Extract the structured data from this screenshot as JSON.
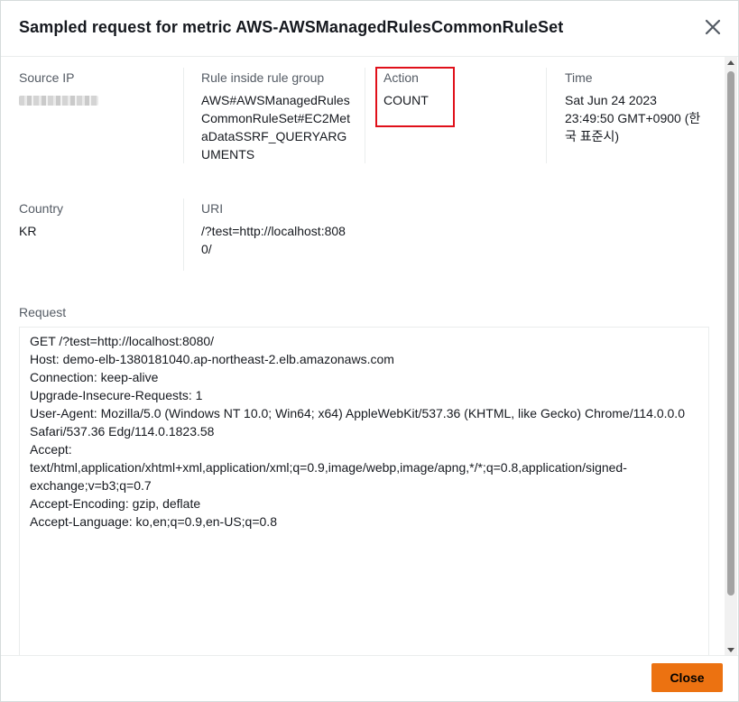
{
  "modal": {
    "title": "Sampled request for metric AWS-AWSManagedRulesCommonRuleSet"
  },
  "details": {
    "source_ip": {
      "label": "Source IP",
      "value": ""
    },
    "rule": {
      "label": "Rule inside rule group",
      "value": "AWS#AWSManagedRulesCommonRuleSet#EC2MetaDataSSRF_QUERYARGUMENTS"
    },
    "action": {
      "label": "Action",
      "value": "COUNT"
    },
    "time": {
      "label": "Time",
      "value": "Sat Jun 24 2023 23:49:50 GMT+0900 (한국 표준시)"
    },
    "country": {
      "label": "Country",
      "value": "KR"
    },
    "uri": {
      "label": "URI",
      "value": "/?test=http://localhost:8080/"
    }
  },
  "request": {
    "label": "Request",
    "lines": [
      "GET /?test=http://localhost:8080/",
      "Host: demo-elb-1380181040.ap-northeast-2.elb.amazonaws.com",
      "Connection: keep-alive",
      "Upgrade-Insecure-Requests: 1",
      "User-Agent: Mozilla/5.0 (Windows NT 10.0; Win64; x64) AppleWebKit/537.36 (KHTML, like Gecko) Chrome/114.0.0.0 Safari/537.36 Edg/114.0.1823.58",
      "Accept:",
      "text/html,application/xhtml+xml,application/xml;q=0.9,image/webp,image/apng,*/*;q=0.8,application/signed-exchange;v=b3;q=0.7",
      "Accept-Encoding: gzip, deflate",
      "Accept-Language: ko,en;q=0.9,en-US;q=0.8"
    ]
  },
  "footer": {
    "close_label": "Close"
  },
  "colors": {
    "accent": "#ec7211",
    "highlight": "#e0101a"
  },
  "icons": {
    "close": "close-icon"
  }
}
